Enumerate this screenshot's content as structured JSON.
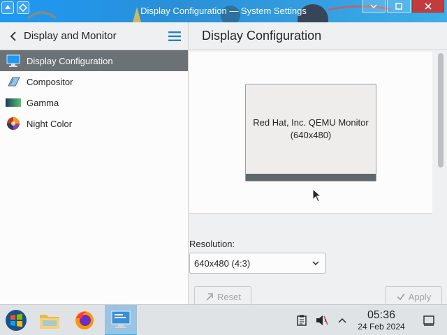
{
  "window": {
    "title": "Display Configuration — System Settings"
  },
  "sidebar": {
    "header": {
      "title": "Display and Monitor"
    },
    "items": [
      {
        "label": "Display Configuration",
        "icon": "display-configuration-icon",
        "active": true
      },
      {
        "label": "Compositor",
        "icon": "compositor-icon",
        "active": false
      },
      {
        "label": "Gamma",
        "icon": "gamma-icon",
        "active": false
      },
      {
        "label": "Night Color",
        "icon": "night-color-icon",
        "active": false
      }
    ]
  },
  "main": {
    "title": "Display Configuration",
    "monitor": {
      "name": "Red Hat, Inc. QEMU Monitor",
      "resolution": "(640x480)"
    },
    "resolution_label": "Resolution:",
    "resolution_value": "640x480 (4:3)",
    "buttons": {
      "reset": "Reset",
      "apply": "Apply"
    }
  },
  "taskbar": {
    "apps": [
      "start-menu-icon",
      "file-manager-icon",
      "firefox-icon",
      "system-settings-icon"
    ],
    "clock": {
      "time": "05:36",
      "date": "24 Feb 2024"
    }
  },
  "colors": {
    "accent": "#3daee9",
    "selection": "#6c7175",
    "close": "#c13c3c"
  }
}
